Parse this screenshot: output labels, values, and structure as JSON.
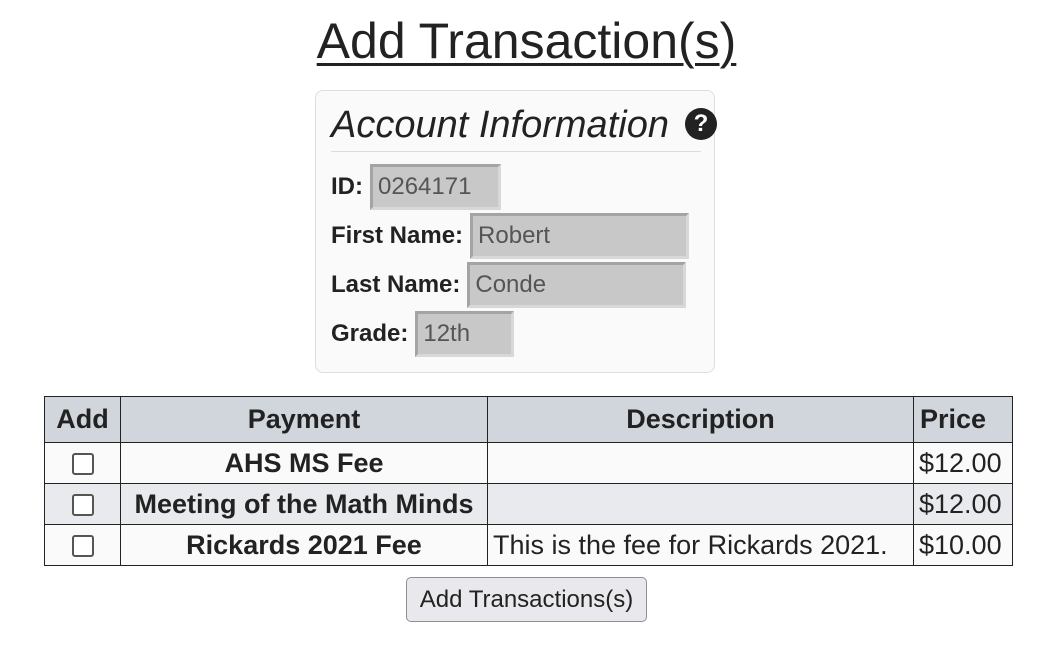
{
  "page": {
    "title": "Add Transaction(s)"
  },
  "account": {
    "title": "Account Information",
    "help_icon": "question-circle-icon",
    "fields": {
      "id": {
        "label": "ID:",
        "value": "0264171"
      },
      "first_name": {
        "label": "First Name:",
        "value": "Robert"
      },
      "last_name": {
        "label": "Last Name:",
        "value": "Conde"
      },
      "grade": {
        "label": "Grade:",
        "value": "12th"
      }
    }
  },
  "table": {
    "headers": [
      "Add",
      "Payment",
      "Description",
      "Price"
    ],
    "rows": [
      {
        "checked": false,
        "payment": "AHS MS Fee",
        "description": "",
        "price": "$12.00"
      },
      {
        "checked": false,
        "payment": "Meeting of the Math Minds",
        "description": "",
        "price": "$12.00"
      },
      {
        "checked": false,
        "payment": "Rickards 2021 Fee",
        "description": "This is the fee for Rickards 2021.",
        "price": "$10.00"
      }
    ]
  },
  "actions": {
    "submit_label": "Add Transactions(s)"
  },
  "colors": {
    "header_bg": "#d1d5dc",
    "row_alt_bg": "#e8eaee",
    "input_bg": "#c8c8c8",
    "text": "#222222"
  }
}
